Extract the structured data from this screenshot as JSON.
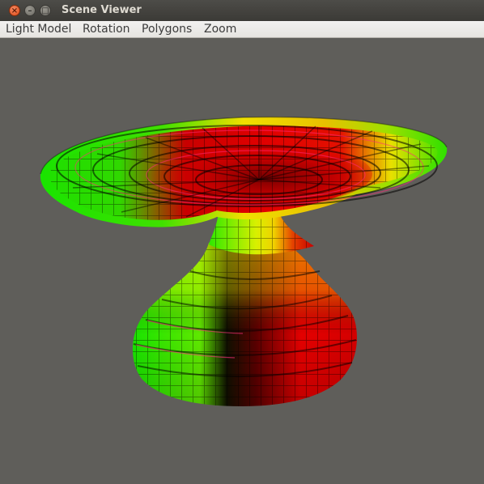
{
  "window": {
    "title": "Scene Viewer"
  },
  "window_controls": {
    "close": "×",
    "minimize": "–",
    "maximize": "□"
  },
  "menubar": {
    "items": [
      "Light Model",
      "Rotation",
      "Polygons",
      "Zoom"
    ]
  },
  "viewport": {
    "background": "#5f5e5a",
    "shape": "wireframe-lit surface of revolution (flared dish over a bulb)",
    "colors": {
      "green": "#19e400",
      "yellow": "#f0f000",
      "red": "#e40000",
      "dark": "#000000"
    }
  }
}
